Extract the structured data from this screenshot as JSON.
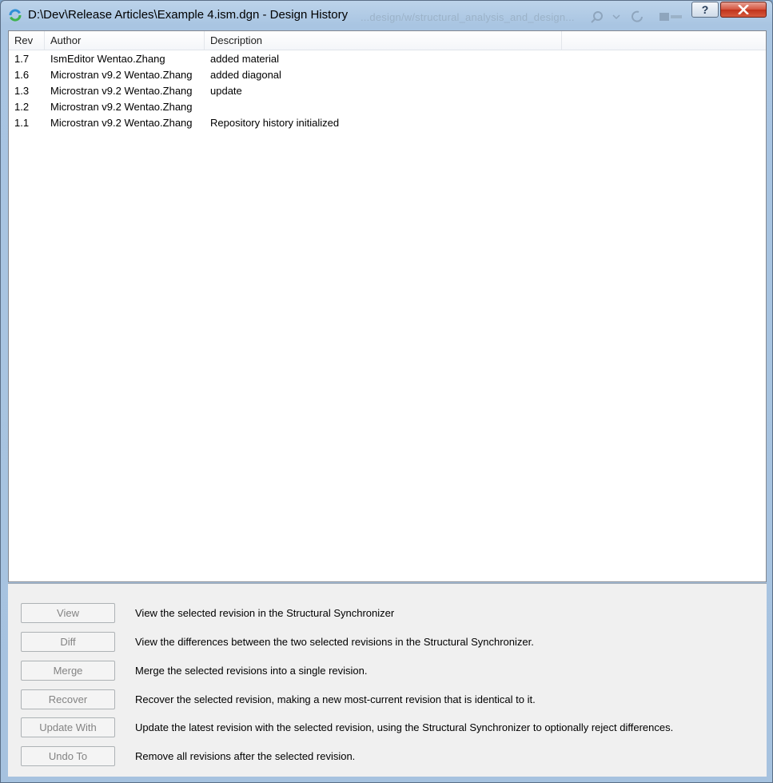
{
  "window": {
    "title": "D:\\Dev\\Release Articles\\Example 4.ism.dgn - Design History",
    "background_title": "...design/w/structural_analysis_and_design..."
  },
  "list": {
    "columns": [
      {
        "key": "rev",
        "label": "Rev"
      },
      {
        "key": "author",
        "label": "Author"
      },
      {
        "key": "description",
        "label": "Description"
      }
    ],
    "rows": [
      {
        "rev": "1.7",
        "author": "IsmEditor Wentao.Zhang",
        "description": "added material"
      },
      {
        "rev": "1.6",
        "author": "Microstran v9.2 Wentao.Zhang",
        "description": "added diagonal"
      },
      {
        "rev": "1.3",
        "author": "Microstran v9.2 Wentao.Zhang",
        "description": "update"
      },
      {
        "rev": "1.2",
        "author": "Microstran v9.2 Wentao.Zhang",
        "description": ""
      },
      {
        "rev": "1.1",
        "author": "Microstran v9.2 Wentao.Zhang",
        "description": "Repository history initialized"
      }
    ]
  },
  "actions": [
    {
      "label": "View",
      "description": "View the selected revision in the Structural Synchronizer",
      "enabled": false
    },
    {
      "label": "Diff",
      "description": "View the differences between the two selected revisions in the Structural Synchronizer.",
      "enabled": false
    },
    {
      "label": "Merge",
      "description": "Merge the selected revisions into a single revision.",
      "enabled": false
    },
    {
      "label": "Recover",
      "description": "Recover the selected revision, making a new most-current revision that is identical to it.",
      "enabled": false
    },
    {
      "label": "Update With",
      "description": "Update the latest revision with the selected revision, using the Structural Synchronizer to optionally reject differences.",
      "enabled": false
    },
    {
      "label": "Undo To",
      "description": "Remove all revisions after the selected revision.",
      "enabled": false
    }
  ],
  "colors": {
    "titlebar": "#a9c5e2",
    "disabled_text": "#838383",
    "close_button": "#c0321b"
  }
}
